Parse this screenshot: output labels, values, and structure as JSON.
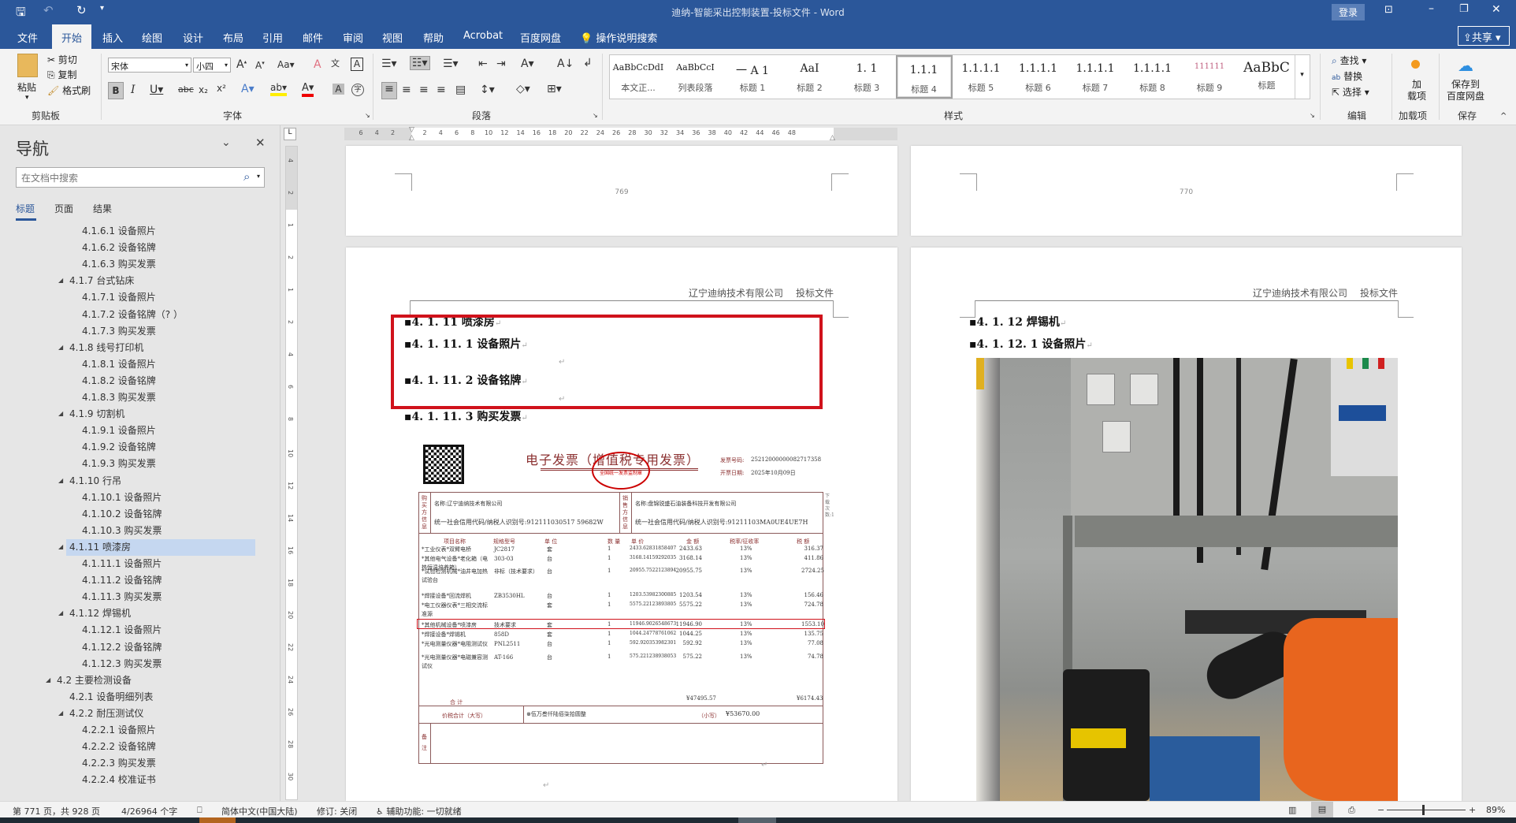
{
  "window": {
    "title": "迪纳-智能采出控制装置-投标文件 - Word",
    "login": "登录",
    "share": "共享"
  },
  "tabs": [
    "文件",
    "开始",
    "插入",
    "绘图",
    "设计",
    "布局",
    "引用",
    "邮件",
    "审阅",
    "视图",
    "帮助",
    "Acrobat",
    "百度网盘"
  ],
  "tell_me": "操作说明搜索",
  "ribbon": {
    "clipboard": {
      "paste": "粘贴",
      "cut": "剪切",
      "copy": "复制",
      "format_painter": "格式刷",
      "label": "剪贴板"
    },
    "font": {
      "name": "宋体",
      "size": "小四",
      "label": "字体"
    },
    "paragraph": {
      "label": "段落"
    },
    "styles": {
      "label": "样式",
      "items": [
        {
          "preview": "AaBbCcDdI",
          "name": "本文正..."
        },
        {
          "preview": "AaBbCcI",
          "name": "列表段落"
        },
        {
          "preview": "一  A 1",
          "name": "标题 1"
        },
        {
          "preview": "AaI",
          "name": "标题 2"
        },
        {
          "preview": "1. 1",
          "name": "标题 3"
        },
        {
          "preview": "1.1.1",
          "name": "标题 4"
        },
        {
          "preview": "1.1.1.1",
          "name": "标题 5"
        },
        {
          "preview": "1.1.1.1",
          "name": "标题 6"
        },
        {
          "preview": "1.1.1.1",
          "name": "标题 7"
        },
        {
          "preview": "1.1.1.1",
          "name": "标题 8"
        },
        {
          "preview": "111111",
          "name": "标题 9"
        },
        {
          "preview": "AaBbC",
          "name": "标题"
        }
      ],
      "selected_index": 5
    },
    "editing": {
      "find": "查找",
      "replace": "替换",
      "select": "选择",
      "label": "编辑"
    },
    "addins": {
      "button": "加\n载项",
      "label": "加载项"
    },
    "save": {
      "button": "保存到\n百度网盘",
      "label": "保存"
    }
  },
  "nav": {
    "title": "导航",
    "search_placeholder": "在文档中搜索",
    "tabs": [
      "标题",
      "页面",
      "结果"
    ],
    "active_tab": 0,
    "items": [
      {
        "level": 3,
        "text": "4.1.6.1 设备照片"
      },
      {
        "level": 3,
        "text": "4.1.6.2 设备铭牌"
      },
      {
        "level": 3,
        "text": "4.1.6.3 购买发票"
      },
      {
        "level": 2,
        "text": "4.1.7 台式钻床"
      },
      {
        "level": 3,
        "text": "4.1.7.1 设备照片"
      },
      {
        "level": 3,
        "text": "4.1.7.2 设备铭牌（? ）"
      },
      {
        "level": 3,
        "text": "4.1.7.3 购买发票"
      },
      {
        "level": 2,
        "text": "4.1.8 线号打印机"
      },
      {
        "level": 3,
        "text": "4.1.8.1 设备照片"
      },
      {
        "level": 3,
        "text": "4.1.8.2 设备铭牌"
      },
      {
        "level": 3,
        "text": "4.1.8.3 购买发票"
      },
      {
        "level": 2,
        "text": "4.1.9 切割机"
      },
      {
        "level": 3,
        "text": "4.1.9.1 设备照片"
      },
      {
        "level": 3,
        "text": "4.1.9.2 设备铭牌"
      },
      {
        "level": 3,
        "text": "4.1.9.3 购买发票"
      },
      {
        "level": 2,
        "text": "4.1.10 行吊"
      },
      {
        "level": 3,
        "text": "4.1.10.1 设备照片"
      },
      {
        "level": 3,
        "text": "4.1.10.2 设备铭牌"
      },
      {
        "level": 3,
        "text": "4.1.10.3 购买发票"
      },
      {
        "level": 2,
        "text": "4.1.11 喷漆房",
        "selected": true
      },
      {
        "level": 3,
        "text": "4.1.11.1 设备照片"
      },
      {
        "level": 3,
        "text": "4.1.11.2 设备铭牌"
      },
      {
        "level": 3,
        "text": "4.1.11.3 购买发票"
      },
      {
        "level": 2,
        "text": "4.1.12 焊锡机"
      },
      {
        "level": 3,
        "text": "4.1.12.1 设备照片"
      },
      {
        "level": 3,
        "text": "4.1.12.2 设备铭牌"
      },
      {
        "level": 3,
        "text": "4.1.12.3 购买发票"
      },
      {
        "level": 1,
        "text": "4.2 主要检测设备"
      },
      {
        "level": 2,
        "text": "4.2.1 设备明细列表",
        "nochild": true
      },
      {
        "level": 2,
        "text": "4.2.2 耐压测试仪"
      },
      {
        "level": 3,
        "text": "4.2.2.1 设备照片"
      },
      {
        "level": 3,
        "text": "4.2.2.2 设备铭牌"
      },
      {
        "level": 3,
        "text": "4.2.2.3 购买发票"
      },
      {
        "level": 3,
        "text": "4.2.2.4 校准证书"
      }
    ]
  },
  "ruler": {
    "h": [
      "6",
      "4",
      "2",
      "",
      "2",
      "4",
      "6",
      "8",
      "10",
      "12",
      "14",
      "16",
      "18",
      "20",
      "22",
      "24",
      "26",
      "28",
      "30",
      "32",
      "34",
      "36",
      "38",
      "40",
      "42",
      "44",
      "46",
      "48"
    ],
    "v": [
      "4",
      "2",
      "1",
      "2",
      "1",
      "2",
      "4",
      "6",
      "8",
      "10",
      "12",
      "14",
      "16",
      "18",
      "20",
      "22",
      "24",
      "26",
      "28",
      "30"
    ]
  },
  "pages": {
    "p769": {
      "number": "769"
    },
    "p770": {
      "number": "770"
    },
    "left": {
      "header_company": "辽宁迪纳技术有限公司",
      "header_doc": "投标文件",
      "headings": [
        "4. 1. 11 喷漆房",
        "4. 1. 11. 1 设备照片",
        "4. 1. 11. 2 设备铭牌",
        "4. 1. 11. 3 购买发票"
      ]
    },
    "right": {
      "header_company": "辽宁迪纳技术有限公司",
      "header_doc": "投标文件",
      "headings": [
        "4. 1. 12 焊锡机",
        "4. 1. 12. 1 设备照片"
      ]
    }
  },
  "invoice": {
    "title": "电子发票（增值税专用发票）",
    "stamp": "全国统一发票监制章",
    "number_label": "发票号码:",
    "number": "25212000000082717358",
    "date_label": "开票日期:",
    "date": "2025年10月09日",
    "buyer_label": "购买方信息",
    "seller_label": "销售方信息",
    "buyer_name": "名称:辽宁迪纳技术有限公司",
    "buyer_tax": "统一社会信用代码/纳税人识别号:912111030517 59682W",
    "seller_name": "名称:盘锦锐盛石油装备科技开发有限公司",
    "seller_tax": "统一社会信用代码/纳税人识别号:91211103MA0UE4UE7H",
    "side_note": "下载次数:1",
    "columns": [
      "项目名称",
      "规格型号",
      "单 位",
      "数 量",
      "单 价",
      "金 额",
      "税率/征收率",
      "税 额"
    ],
    "rows": [
      [
        "*工业仪表*双臂电桥",
        "JC2817",
        "套",
        "1",
        "2433.62831858407",
        "2433.63",
        "13%",
        "316.37"
      ],
      [
        "*其他电气设备*老化箱（电热恒温培养箱）",
        "303-03",
        "台",
        "1",
        "3168.14159292035",
        "3168.14",
        "13%",
        "411.86"
      ],
      [
        "*试验检测机械*油井电加热试验台",
        "非标（技术要求）",
        "台",
        "1",
        "20955.7522123894",
        "20955.75",
        "13%",
        "2724.25"
      ],
      [
        "*焊接设备*回流焊机",
        "ZB3530HL",
        "台",
        "1",
        "1203.53982300885",
        "1203.54",
        "13%",
        "156.46"
      ],
      [
        "*电工仪器仪表*三相交流标准源",
        "",
        "套",
        "1",
        "5575.22123893805",
        "5575.22",
        "13%",
        "724.78"
      ],
      [
        "*其他机械设备*喷漆房",
        "技术要求",
        "套",
        "1",
        "11946.9026548673",
        "11946.90",
        "13%",
        "1553.10"
      ],
      [
        "*焊接设备*焊锡机",
        "858D",
        "套",
        "1",
        "1044.24778761062",
        "1044.25",
        "13%",
        "135.75"
      ],
      [
        "*光电测量仪器*电阻测试仪",
        "PNL2511",
        "台",
        "1",
        "592.920353982301",
        "592.92",
        "13%",
        "77.08"
      ],
      [
        "*光电测量仪器*电磁兼容测试仪",
        "AT-166",
        "台",
        "1",
        "575.221238938053",
        "575.22",
        "13%",
        "74.78"
      ]
    ],
    "highlighted_row": 5,
    "total_label": "合          计",
    "total_amount": "¥47495.57",
    "total_tax": "¥6174.43",
    "grand_label": "价税合计（大写）",
    "grand_words": "伍万叁仟陆佰柒拾圆整",
    "grand_small_label": "（小写）",
    "grand_value": "¥53670.00",
    "remark_label": "备注"
  },
  "status": {
    "page": "第 771 页，共 928 页",
    "words": "4/26964 个字",
    "language": "简体中文(中国大陆)",
    "track": "修订: 关闭",
    "accessibility": "辅助功能: 一切就绪",
    "zoom": "89%",
    "zoom_percent": 89
  },
  "colors": {
    "brand": "#2b579a",
    "highlight_box": "#d0121b",
    "invoice_line": "#8b5a5a"
  }
}
